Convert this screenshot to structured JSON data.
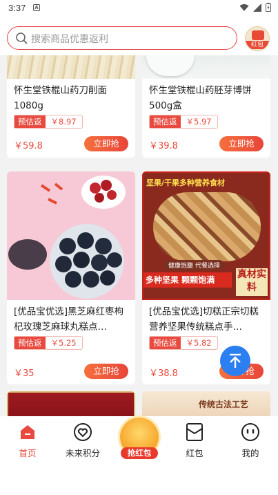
{
  "statusbar": {
    "time": "3:37",
    "notif_glyph": "A"
  },
  "search": {
    "placeholder": "搜索商品优惠返利",
    "redpacket_label": "红包"
  },
  "products": [
    {
      "title": "怀生堂铁棍山药刀削面1080g",
      "rebate_label": "预估返",
      "rebate_value": "￥8.97",
      "price": "￥59.8",
      "buy_label": "立即抢"
    },
    {
      "title": "怀生堂铁棍山药胚芽博饼500g盒",
      "rebate_label": "预估返",
      "rebate_value": "￥5.97",
      "price": "￥39.8",
      "buy_label": "立即抢"
    },
    {
      "title": "[优品宝优选]黑芝麻红枣枸杞玫瑰芝麻球丸糕点…",
      "rebate_label": "预估返",
      "rebate_value": "￥5.25",
      "price": "￥35",
      "buy_label": "立即抢"
    },
    {
      "title": "[优品宝优选]切糕正宗切糕营养坚果传统糕点手…",
      "rebate_label": "预估返",
      "rebate_value": "￥5.82",
      "price": "￥38.8",
      "buy_label": "立即抢",
      "image_text": {
        "top": "坚果/干果多种营养食材",
        "badge": "健康饱腹 代餐选择",
        "bottom": "多种坚果 颗颗饱满",
        "side": "真材实料"
      }
    },
    {
      "image_text": ""
    },
    {
      "image_text": "传统古法工艺"
    }
  ],
  "tabs": [
    {
      "label": "首页"
    },
    {
      "label": "未来积分"
    },
    {
      "label": "抢红包"
    },
    {
      "label": "红包"
    },
    {
      "label": "我的"
    }
  ],
  "colors": {
    "accent": "#e84a3f",
    "fab": "#2b7ff0"
  }
}
